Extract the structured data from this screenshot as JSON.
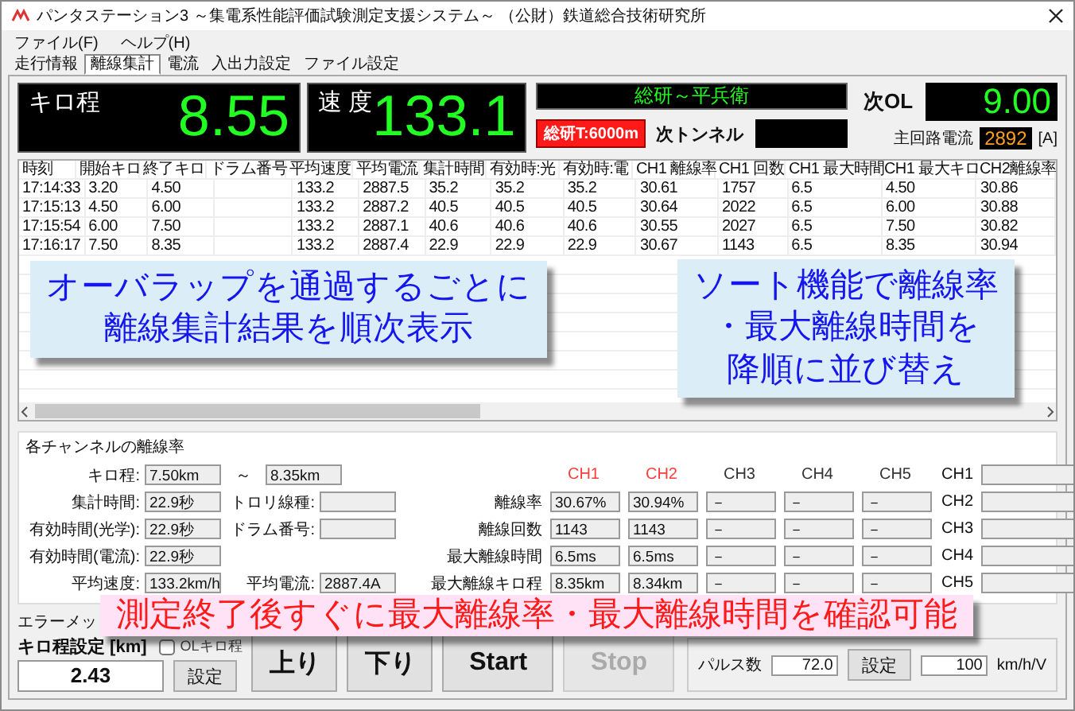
{
  "window": {
    "title": "パンタステーション3 ～集電系性能評価試験測定支援システム～ （公財）鉄道総合技術研究所"
  },
  "menu": [
    "ファイル(F)",
    "ヘルプ(H)"
  ],
  "tabs": [
    {
      "label": "走行情報",
      "selected": false
    },
    {
      "label": "離線集計",
      "selected": true
    },
    {
      "label": "電流",
      "selected": false
    },
    {
      "label": "入出力設定",
      "selected": false
    },
    {
      "label": "ファイル設定",
      "selected": false
    }
  ],
  "displays": {
    "kilo": {
      "label": "キロ程",
      "value": "8.55"
    },
    "speed": {
      "label": "速 度",
      "value": "133.1"
    },
    "section": "総研～平兵衛",
    "tunnel_alert": "総研T:6000m",
    "next_tunnel": "次トンネル",
    "next_ol": {
      "label": "次OL",
      "value": "9.00"
    },
    "main_current": {
      "label": "主回路電流",
      "value": "2892",
      "unit": "[A]"
    }
  },
  "table": {
    "columns": [
      "時刻",
      "開始キロ",
      "終了キロ",
      "ドラム番号",
      "平均速度",
      "平均電流",
      "集計時間",
      "有効時:光",
      "有効時:電",
      "CH1 離線率",
      "CH1 回数",
      "CH1 最大時間",
      "CH1 最大キロ",
      "CH2離線率"
    ],
    "rows": [
      [
        "17:14:33",
        "3.20",
        "4.50",
        null,
        "133.2",
        "2887.5",
        "35.2",
        "35.2",
        "35.2",
        "30.61",
        "1757",
        "6.5",
        "4.50",
        "30.86"
      ],
      [
        "17:15:13",
        "4.50",
        "6.00",
        null,
        "133.2",
        "2887.2",
        "40.5",
        "40.5",
        "40.5",
        "30.64",
        "2022",
        "6.5",
        "6.00",
        "30.88"
      ],
      [
        "17:15:54",
        "6.00",
        "7.50",
        null,
        "133.2",
        "2887.1",
        "40.6",
        "40.6",
        "40.6",
        "30.55",
        "2027",
        "6.5",
        "7.50",
        "30.82"
      ],
      [
        "17:16:17",
        "7.50",
        "8.35",
        null,
        "133.2",
        "2887.4",
        "22.9",
        "22.9",
        "22.9",
        "30.67",
        "1143",
        "6.5",
        "8.35",
        "30.94"
      ]
    ]
  },
  "channel_rates": {
    "title": "各チャンネルの離線率",
    "summary": [
      [
        {
          "label": "キロ程:",
          "value": "7.50km",
          "separator": "～",
          "value_end": "8.35km"
        }
      ],
      [
        {
          "label": "集計時間:",
          "value": "22.9秒"
        },
        {
          "label": "トロリ線種:"
        }
      ],
      [
        {
          "label": "有効時間(光学):",
          "value": "22.9秒"
        },
        {
          "label": "ドラム番号:"
        }
      ],
      [
        {
          "label": "有効時間(電流):",
          "value": "22.9秒"
        }
      ],
      [
        {
          "label": "平均速度:",
          "value": "133.2km/h"
        },
        {
          "label": "平均電流:",
          "value": "2887.4A"
        }
      ]
    ],
    "metrics": [
      "離線率",
      "離線回数",
      "最大離線時間",
      "最大離線キロ程"
    ],
    "channels": [
      {
        "name": "CH1",
        "color": "#ff3b3b",
        "values": [
          "30.67%",
          "1143",
          "6.5ms",
          "8.35km"
        ]
      },
      {
        "name": "CH2",
        "color": "#ff3b3b",
        "values": [
          "30.94%",
          "1143",
          "6.5ms",
          "8.34km"
        ]
      },
      {
        "name": "CH3",
        "color": "#333333",
        "values": [
          "－",
          "－",
          "－",
          "－"
        ]
      },
      {
        "name": "CH4",
        "color": "#333333",
        "values": [
          "－",
          "－",
          "－",
          "－"
        ]
      },
      {
        "name": "CH5",
        "color": "#333333",
        "values": [
          "－",
          "－",
          "－",
          "－"
        ]
      }
    ],
    "channel_fields": [
      "CH1",
      "CH2",
      "CH3",
      "CH4",
      "CH5"
    ]
  },
  "controls": {
    "error_label": "エラーメッ",
    "kilo_setting": {
      "label": "キロ程設定 [km]",
      "value": "2.43",
      "button": "設定"
    },
    "ol_checkbox": {
      "label": "OLキロ程",
      "checked": false
    },
    "direction_buttons": [
      "上り",
      "下り"
    ],
    "run_buttons": [
      {
        "label": "Start",
        "disabled": false
      },
      {
        "label": "Stop",
        "disabled": true
      }
    ],
    "pulse": {
      "label": "パルス数",
      "value": "72.0",
      "button": "設定"
    },
    "speed_factor": {
      "value": "100",
      "unit": "km/h/V"
    }
  },
  "callouts": [
    {
      "kind": "blue",
      "lines": [
        "オーバラップを通過するごとに",
        "離線集計結果を順次表示"
      ]
    },
    {
      "kind": "blue",
      "lines": [
        "ソート機能で離線率",
        "・最大離線時間を",
        "降順に並び替え"
      ]
    },
    {
      "kind": "pink",
      "lines": [
        "測定終了後すぐに最大離線率・最大離線時間を確認可能"
      ]
    }
  ]
}
